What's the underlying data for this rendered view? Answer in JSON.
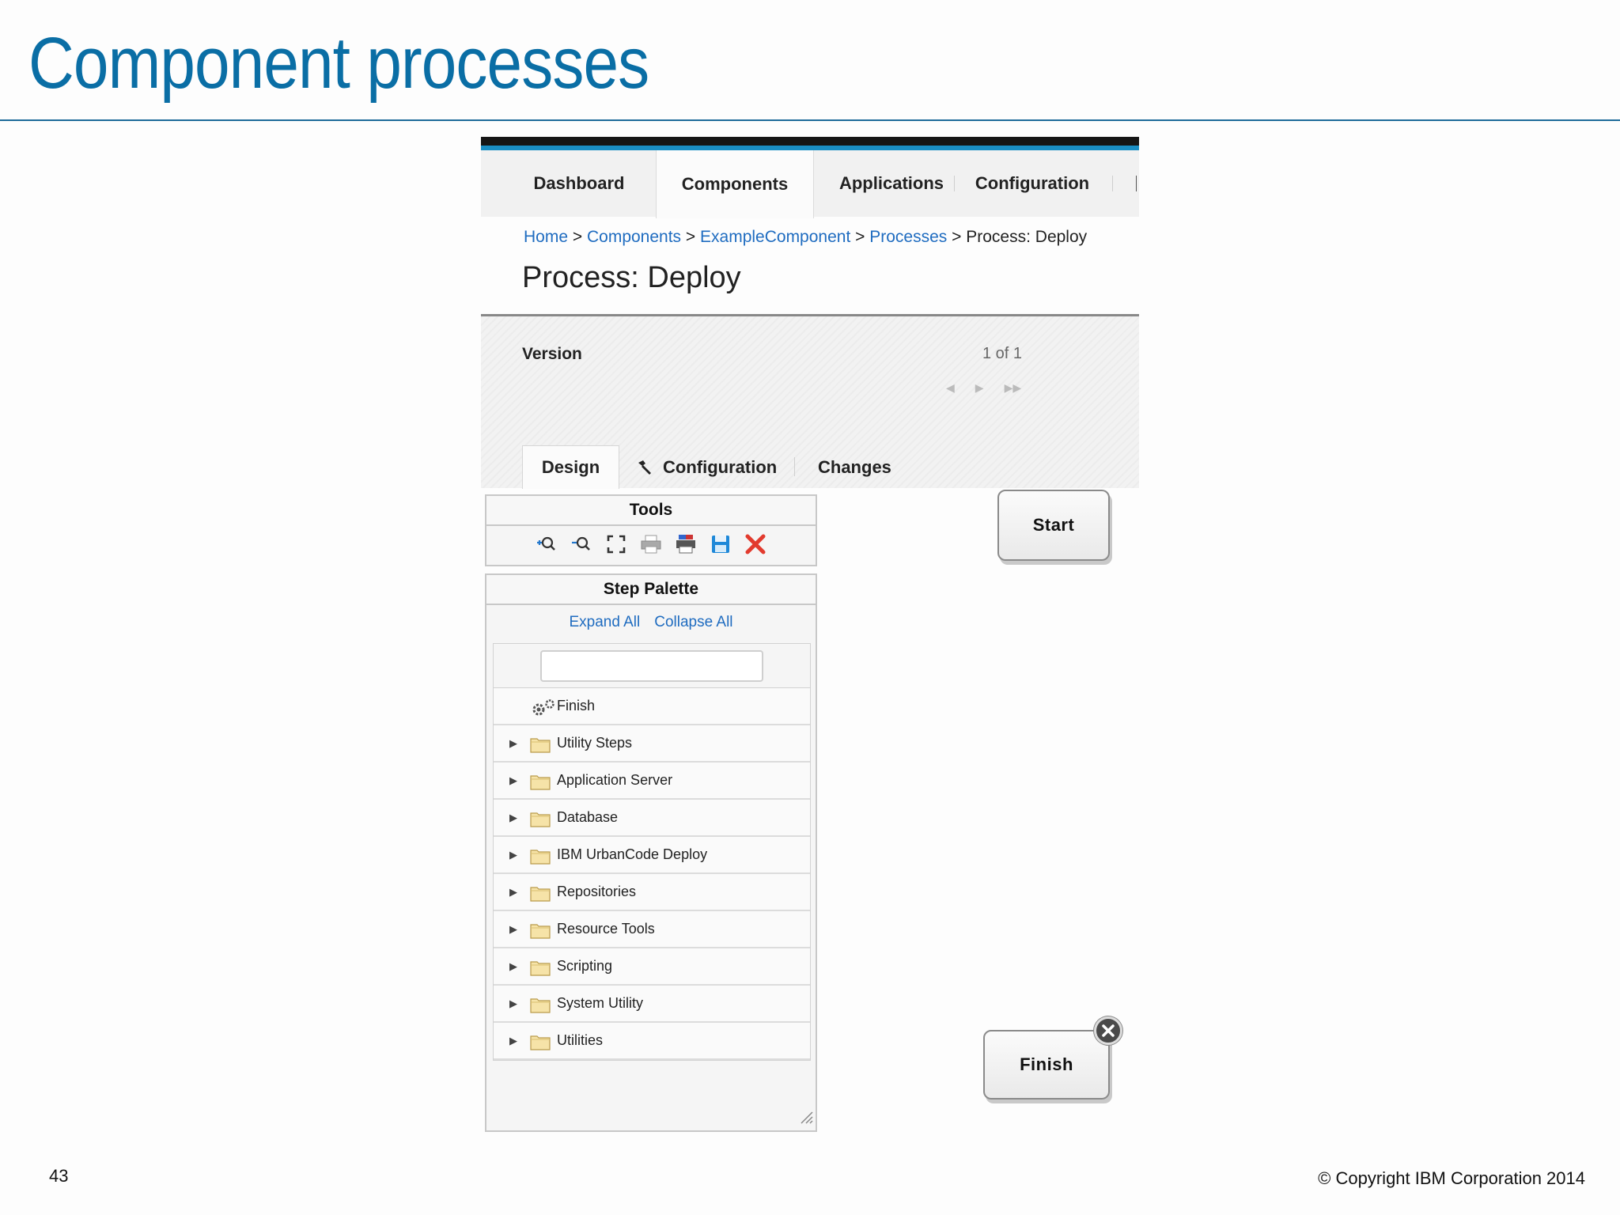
{
  "slide": {
    "title": "Component processes",
    "page_number": "43",
    "copyright": "© Copyright IBM Corporation 2014"
  },
  "nav": {
    "tabs": [
      {
        "label": "Dashboard"
      },
      {
        "label": "Components",
        "active": true
      },
      {
        "label": "Applications"
      },
      {
        "label": "Configuration"
      }
    ]
  },
  "breadcrumb": {
    "home": "Home",
    "components": "Components",
    "component": "ExampleComponent",
    "processes": "Processes",
    "current": "Process: Deploy",
    "separator": ">"
  },
  "page": {
    "heading": "Process: Deploy",
    "version_label": "Version",
    "version_count": "1 of 1"
  },
  "subtabs": [
    {
      "label": "Design",
      "active": true
    },
    {
      "label": "Configuration",
      "icon": "wrench-icon"
    },
    {
      "label": "Changes"
    }
  ],
  "tools": {
    "title": "Tools",
    "icons": [
      "zoom-in-icon",
      "zoom-out-icon",
      "fit-screen-icon",
      "print-icon",
      "print-preview-icon",
      "save-icon",
      "delete-icon"
    ]
  },
  "palette": {
    "title": "Step Palette",
    "expand_all": "Expand All",
    "collapse_all": "Collapse All",
    "search_value": "",
    "finish_item": "Finish",
    "folders": [
      "Utility Steps",
      "Application Server",
      "Database",
      "IBM UrbanCode Deploy",
      "Repositories",
      "Resource Tools",
      "Scripting",
      "System Utility",
      "Utilities"
    ]
  },
  "canvas": {
    "start_label": "Start",
    "finish_label": "Finish"
  },
  "colors": {
    "title_blue": "#0a6ea5",
    "link_blue": "#1f6cc0",
    "accent_bar": "#1a8ec4",
    "delete_red": "#e23b2e"
  }
}
